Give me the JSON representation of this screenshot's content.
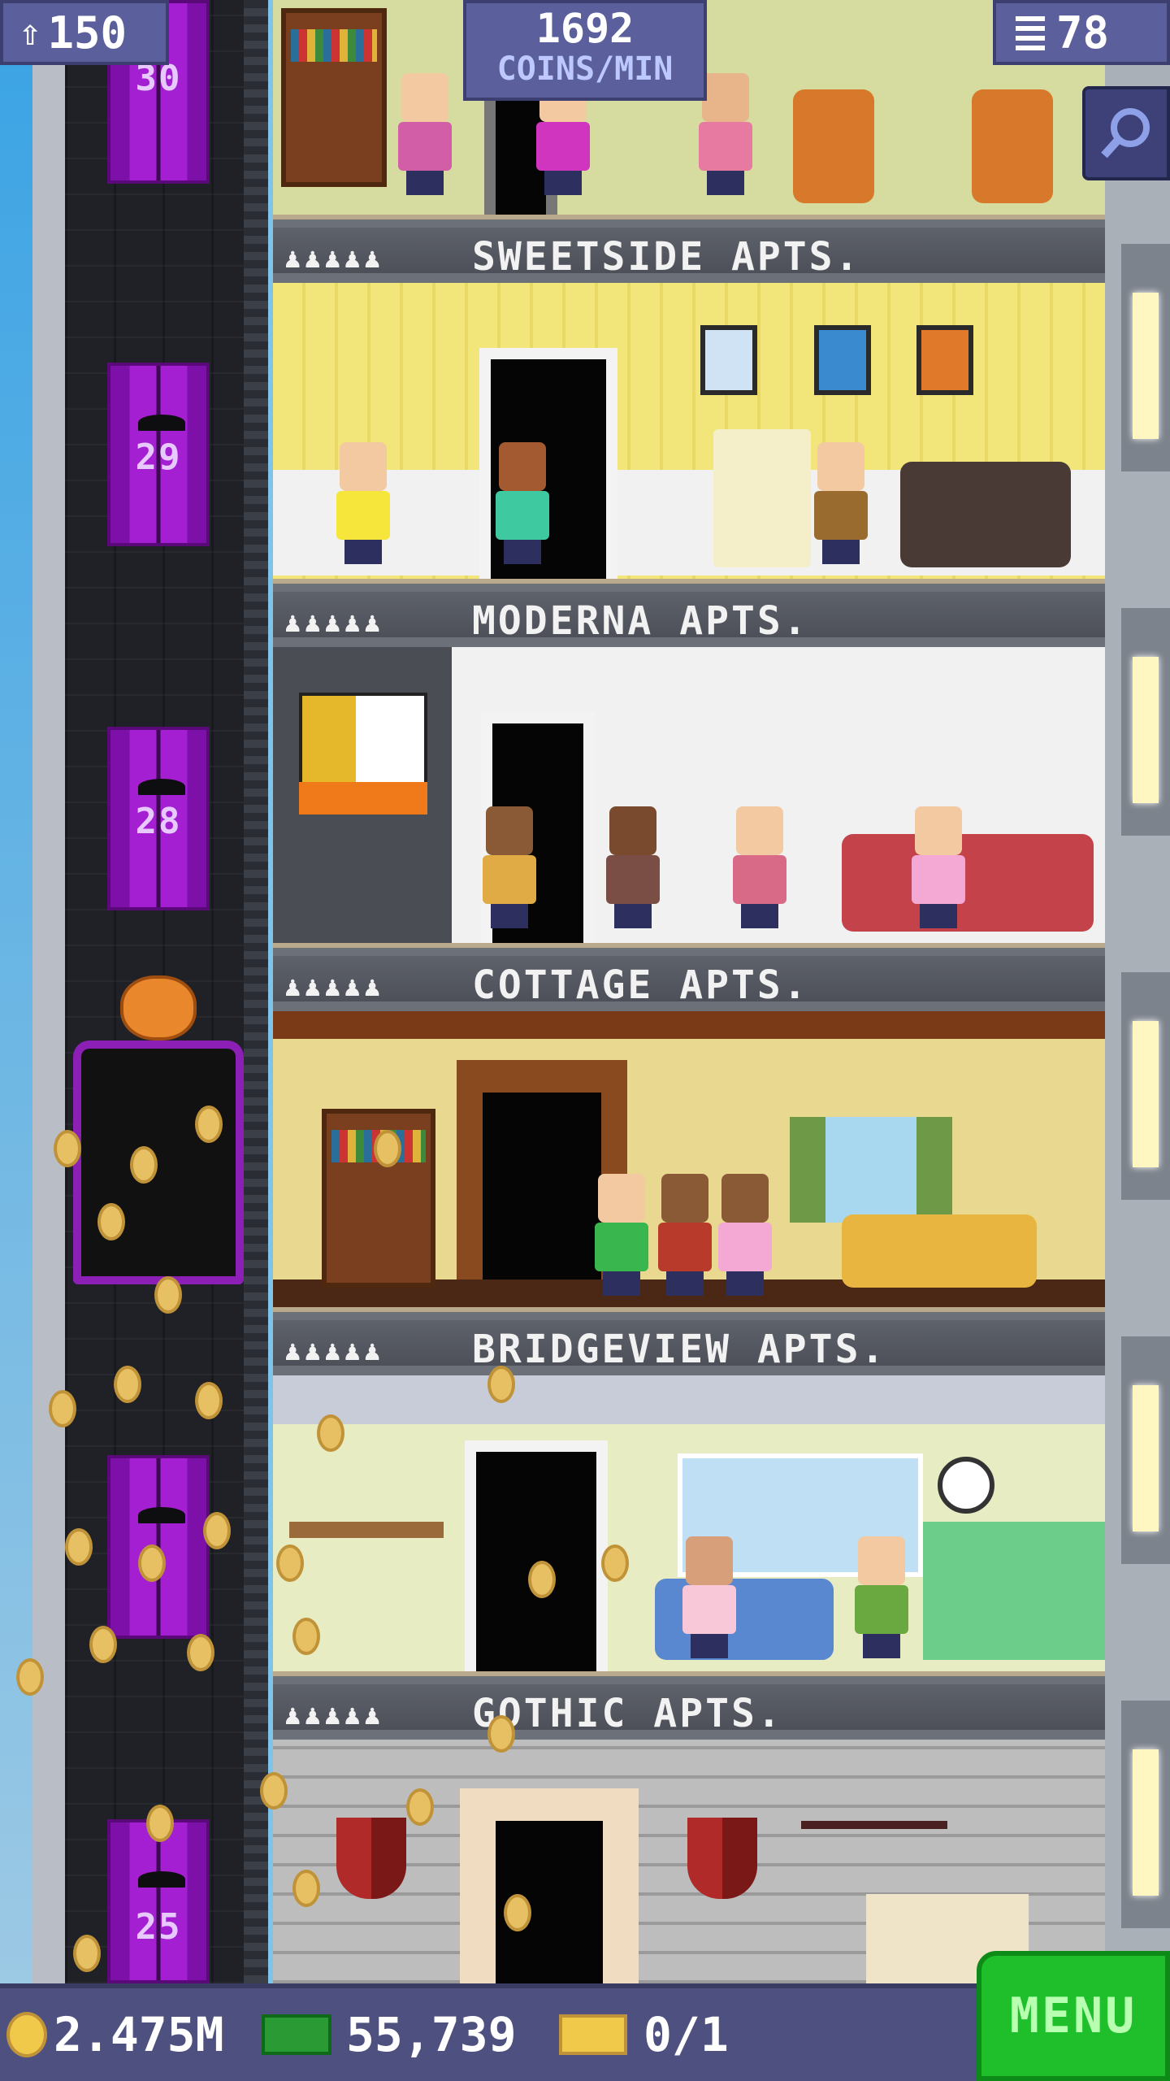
{
  "hud": {
    "population": "150",
    "coins_per_min_value": "1692",
    "coins_per_min_label": "COINS/MIN",
    "floors": "78"
  },
  "elevator": {
    "floor_numbers": [
      "30",
      "29",
      "28",
      "25"
    ]
  },
  "floors": [
    {
      "name": "SWEETSIDE APTS.",
      "residents_icons": "♟♟♟♟♟"
    },
    {
      "name": "MODERNA APTS.",
      "residents_icons": "♟♟♟♟♟"
    },
    {
      "name": "COTTAGE APTS.",
      "residents_icons": "♟♟♟♟♟"
    },
    {
      "name": "BRIDGEVIEW APTS.",
      "residents_icons": "♟♟♟♟♟"
    },
    {
      "name": "GOTHIC APTS.",
      "residents_icons": "♟♟♟♟♟"
    }
  ],
  "bottom_bar": {
    "coins": "2.475M",
    "bux": "55,739",
    "tickets": "0/1",
    "menu_label": "MENU"
  },
  "colors": {
    "hud_bg": "#5b5f9c",
    "menu_green": "#1ebf2a",
    "elevator_purple": "#a41ed2"
  },
  "icons": {
    "population": "person-upload-icon",
    "floors": "building-icon",
    "search": "magnifier-icon",
    "coins": "coin-icon",
    "bux": "cash-icon",
    "tickets": "ticket-icon"
  }
}
